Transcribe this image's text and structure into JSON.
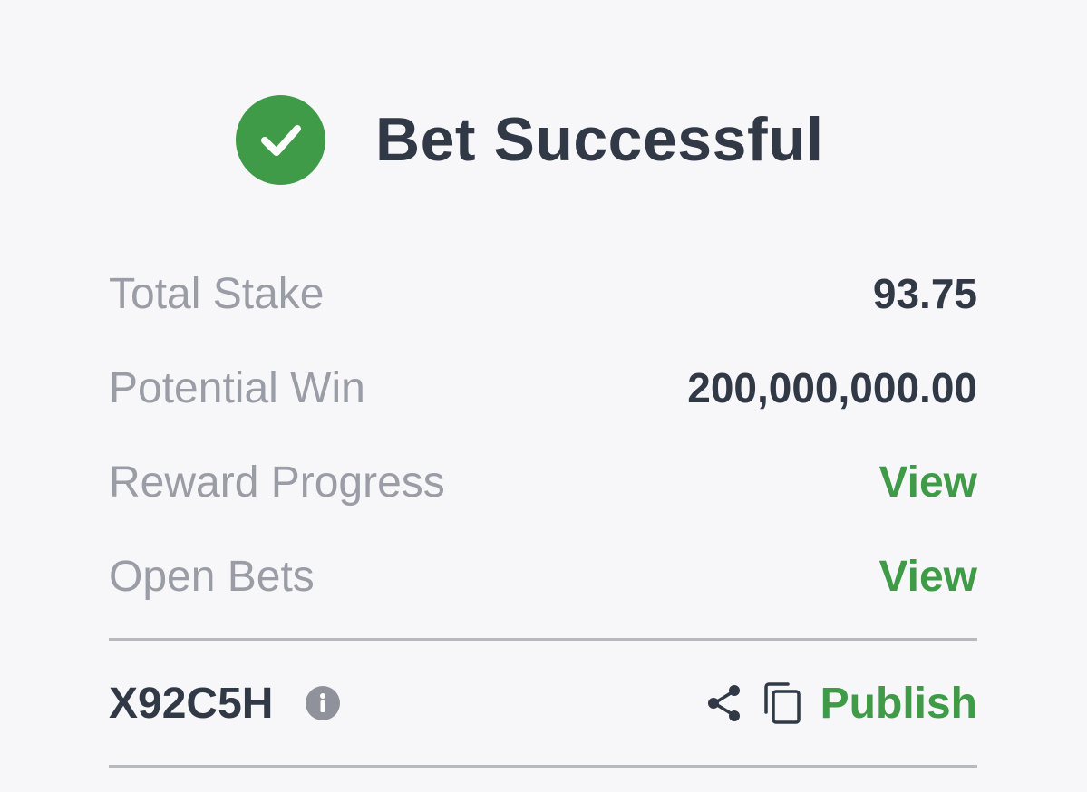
{
  "header": {
    "icon": "check-circle-icon",
    "title": "Bet Successful"
  },
  "summary": {
    "rows": [
      {
        "label": "Total Stake",
        "value": "93.75"
      },
      {
        "label": "Potential Win",
        "value": "200,000,000.00"
      },
      {
        "label": "Reward Progress",
        "link": "View"
      },
      {
        "label": "Open Bets",
        "link": "View"
      }
    ]
  },
  "booking": {
    "code": "X92C5H",
    "info_icon": "info-icon",
    "share_icon": "share-icon",
    "copy_icon": "copy-icon",
    "publish_label": "Publish"
  },
  "colors": {
    "accent": "#3f9b48",
    "text_primary": "#313846",
    "text_secondary": "#9a9da6",
    "background": "#f7f7f9"
  }
}
